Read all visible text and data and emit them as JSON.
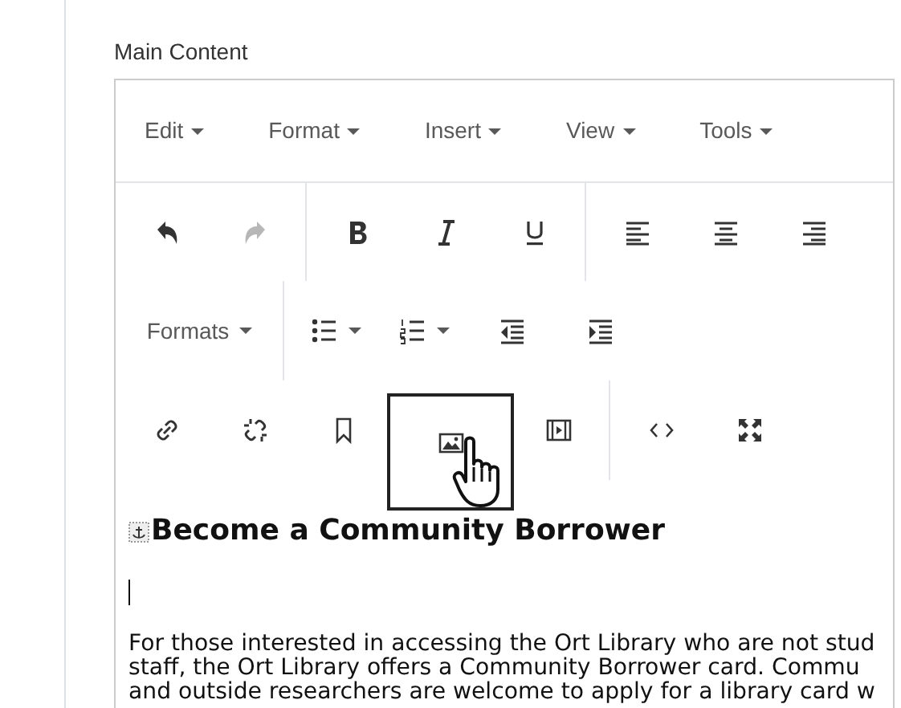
{
  "field_label": "Main Content",
  "menus": [
    {
      "label": "Edit"
    },
    {
      "label": "Format"
    },
    {
      "label": "Insert"
    },
    {
      "label": "View"
    },
    {
      "label": "Tools"
    }
  ],
  "toolbar_rows": [
    [
      [
        {
          "kind": "undo",
          "disabled": false,
          "hovered": false
        },
        {
          "kind": "redo",
          "disabled": true,
          "hovered": false
        }
      ],
      [
        {
          "kind": "bold",
          "disabled": false,
          "hovered": false
        },
        {
          "kind": "italic",
          "disabled": false,
          "hovered": false
        },
        {
          "kind": "underline",
          "disabled": false,
          "hovered": false
        }
      ],
      [
        {
          "kind": "alignleft",
          "disabled": false,
          "hovered": false
        },
        {
          "kind": "aligncenter",
          "disabled": false,
          "hovered": false
        },
        {
          "kind": "alignright",
          "disabled": false,
          "hovered": false
        }
      ]
    ],
    [
      [
        {
          "kind": "formats",
          "label": "Formats",
          "disabled": false,
          "hovered": false
        }
      ],
      [
        {
          "kind": "bullist",
          "disabled": false,
          "hovered": false
        },
        {
          "kind": "numlist",
          "disabled": false,
          "hovered": false
        },
        {
          "kind": "outdent",
          "disabled": false,
          "hovered": false
        },
        {
          "kind": "indent",
          "disabled": false,
          "hovered": false
        }
      ]
    ],
    [
      [
        {
          "kind": "link",
          "disabled": false,
          "hovered": false
        },
        {
          "kind": "unlink",
          "disabled": false,
          "hovered": false
        },
        {
          "kind": "anchor",
          "disabled": false,
          "hovered": false
        },
        {
          "kind": "image",
          "disabled": false,
          "hovered": true
        },
        {
          "kind": "media",
          "disabled": false,
          "hovered": false
        }
      ],
      [
        {
          "kind": "code",
          "disabled": false,
          "hovered": false
        },
        {
          "kind": "fullscreen",
          "disabled": false,
          "hovered": false
        }
      ]
    ]
  ],
  "content": {
    "heading": "Become a Community Borrower",
    "paragraph_lines": [
      "For those interested in accessing the Ort Library who are not stud",
      "staff, the Ort Library offers a Community Borrower card. Commu",
      "and outside researchers are welcome to apply for a library card w"
    ]
  }
}
